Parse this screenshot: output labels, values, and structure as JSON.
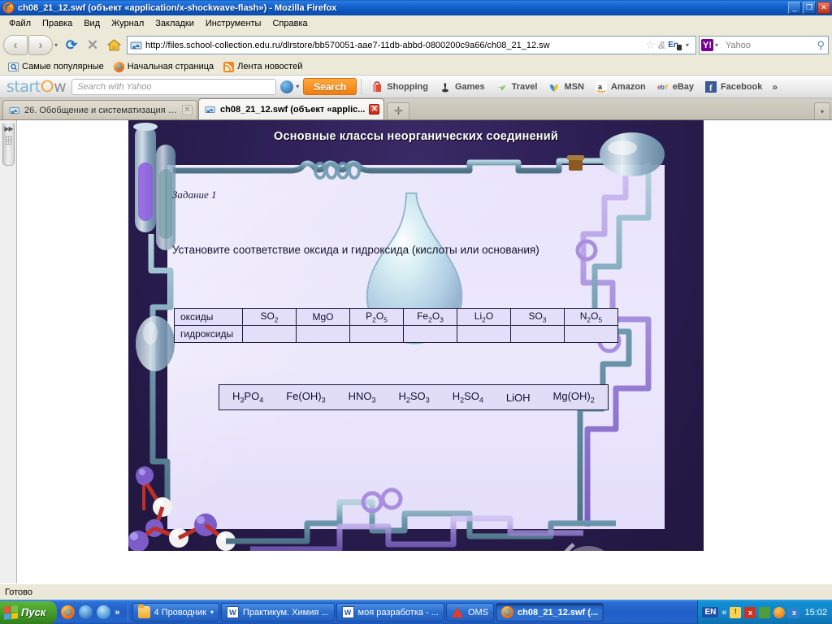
{
  "window": {
    "title": "ch08_21_12.swf (объект «application/x-shockwave-flash») - Mozilla Firefox",
    "minimize_label": "_",
    "maximize_label": "❐",
    "close_label": "✕"
  },
  "menu": {
    "items": [
      {
        "label": "Файл"
      },
      {
        "label": "Правка"
      },
      {
        "label": "Вид"
      },
      {
        "label": "Журнал"
      },
      {
        "label": "Закладки"
      },
      {
        "label": "Инструменты"
      },
      {
        "label": "Справка"
      }
    ]
  },
  "navbar": {
    "back_label": "‹",
    "forward_label": "›",
    "dropdown_label": "▾",
    "reload_label": "⟳",
    "stop_label": "✕",
    "home_icon": "home-icon",
    "url": "http://files.school-collection.edu.ru/dlrstore/bb570051-aae7-11db-abbd-0800200c9a66/ch08_21_12.sw",
    "star_label": "☆",
    "amp_label": "&",
    "lang_badge": "En",
    "search_placeholder": "Yahoo",
    "search_engine": "Y!",
    "search_caret": "▾",
    "magnify_label": "⚲"
  },
  "bookmarks": {
    "items": [
      {
        "label": "Самые популярные",
        "icon": "bookmark-folder-icon"
      },
      {
        "label": "Начальная страница",
        "icon": "firefox-icon"
      },
      {
        "label": "Лента новостей",
        "icon": "rss-icon"
      }
    ]
  },
  "startnow": {
    "logo_start": "start",
    "logo_ring": "ⵔ",
    "logo_end": "w",
    "search_placeholder": "Search with Yahoo",
    "search_caret": "▾",
    "search_button": "Search",
    "links": [
      {
        "label": "Shopping",
        "icon": "shopping-bag-icon"
      },
      {
        "label": "Games",
        "icon": "joystick-icon"
      },
      {
        "label": "Travel",
        "icon": "travel-icon"
      },
      {
        "label": "MSN",
        "icon": "msn-butterfly-icon"
      },
      {
        "label": "Amazon",
        "icon": "amazon-icon"
      },
      {
        "label": "eBay",
        "icon": "ebay-icon"
      },
      {
        "label": "Facebook",
        "icon": "facebook-icon"
      }
    ],
    "more_label": "»"
  },
  "tabs": {
    "items": [
      {
        "label": "26. Обобщение и систематизация зн...",
        "close": "✕",
        "active": false
      },
      {
        "label": "ch08_21_12.swf (объект «applic...",
        "close": "✕",
        "active": true
      }
    ],
    "new_tab_label": "✛",
    "tab_list_label": "▾"
  },
  "sidebar": {
    "arrows_label": "▶▶"
  },
  "flash": {
    "title": "Основные классы неорганических соединений",
    "task_label": "Задание 1",
    "task_text": "Установите соответствие оксида и гидроксида (кислоты или основания)",
    "table": {
      "row_headers": [
        "оксиды",
        "гидроксиды"
      ],
      "oxides": [
        {
          "main": "SO",
          "sub": "2",
          "tail": ""
        },
        {
          "main": "MgO",
          "sub": "",
          "tail": ""
        },
        {
          "main": "P",
          "sub": "2",
          "tail": "O",
          "sub2": "5"
        },
        {
          "main": "Fe",
          "sub": "2",
          "tail": "O",
          "sub2": "3"
        },
        {
          "main": "Li",
          "sub": "2",
          "tail": "O",
          "sub2": ""
        },
        {
          "main": "SO",
          "sub": "3",
          "tail": ""
        },
        {
          "main": "N",
          "sub": "2",
          "tail": "O",
          "sub2": "5"
        }
      ],
      "oxides_plain": [
        "SO2",
        "MgO",
        "P2O5",
        "Fe2O3",
        "Li2O",
        "SO3",
        "N2O5"
      ],
      "hydroxides_plain": [
        "",
        "",
        "",
        "",
        "",
        "",
        ""
      ]
    },
    "answer_bank": [
      "H3PO4",
      "Fe(OH)3",
      "HNO3",
      "H2SO3",
      "H2SO4",
      "LiOH",
      "Mg(OH)2"
    ]
  },
  "statusbar": {
    "text": "Готово"
  },
  "taskbar": {
    "start_label": "Пуск",
    "quicklaunch": [
      {
        "icon": "firefox-icon"
      },
      {
        "icon": "media-player-icon"
      },
      {
        "icon": "internet-explorer-icon"
      }
    ],
    "quicklaunch_more": "»",
    "buttons": [
      {
        "label": "4 Проводник",
        "icon": "folder-icon",
        "caret": "▾",
        "active": false
      },
      {
        "label": "Практикум. Химия ...",
        "icon": "word-icon",
        "caret": "",
        "active": false
      },
      {
        "label": "моя разработка - ...",
        "icon": "word-icon",
        "caret": "",
        "active": false
      },
      {
        "label": "OMS",
        "icon": "oms-icon",
        "caret": "",
        "active": false
      },
      {
        "label": "ch08_21_12.swf (...",
        "icon": "firefox-icon",
        "caret": "",
        "active": true
      }
    ],
    "tray": {
      "language": "EN",
      "chevron": "«",
      "icons": [
        "shield-icon",
        "antivirus-icon",
        "network-icon",
        "recorder-icon",
        "updates-icon"
      ],
      "clock": "15:02"
    }
  },
  "colors": {
    "titlebar_blue": "#1462cf",
    "stage_bg": "#251a4a",
    "panel_lavender": "#ece8fc",
    "startnow_orange": "#f07d10",
    "taskbar_blue": "#2465cc",
    "start_green": "#46a02b"
  }
}
